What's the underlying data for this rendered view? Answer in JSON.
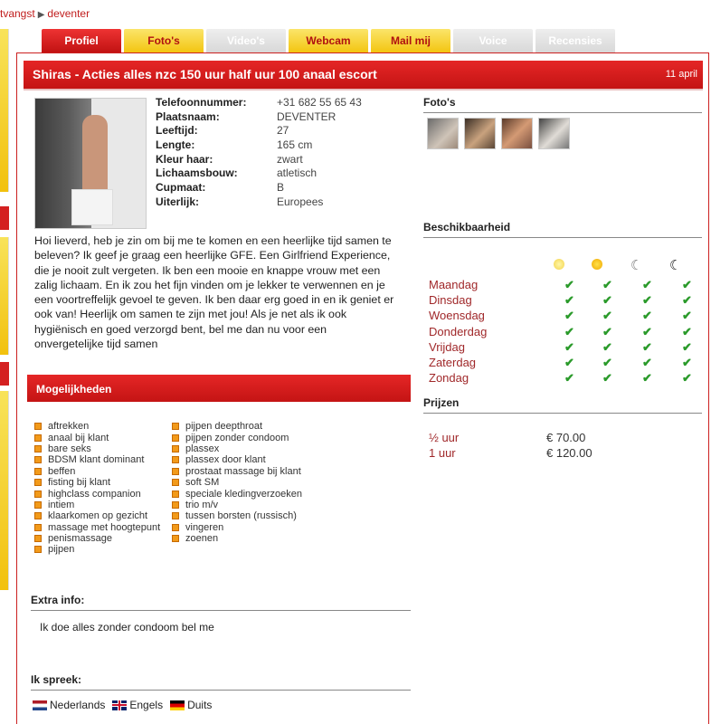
{
  "breadcrumb": {
    "first": "tvangst",
    "second": "deventer"
  },
  "tabs": [
    {
      "label": "Profiel"
    },
    {
      "label": "Foto's"
    },
    {
      "label": "Video's"
    },
    {
      "label": "Webcam"
    },
    {
      "label": "Mail mij"
    },
    {
      "label": "Voice"
    },
    {
      "label": "Recensies"
    }
  ],
  "profile": {
    "title": "Shiras - Acties alles nzc 150 uur half uur 100 anaal escort",
    "date": "11 april",
    "details": [
      {
        "label": "Telefoonnummer:",
        "value": "+31 682 55 65 43"
      },
      {
        "label": "Plaatsnaam:",
        "value": "DEVENTER"
      },
      {
        "label": "Leeftijd:",
        "value": "27"
      },
      {
        "label": "Lengte:",
        "value": "165 cm"
      },
      {
        "label": "Kleur haar:",
        "value": "zwart"
      },
      {
        "label": "Lichaamsbouw:",
        "value": "atletisch"
      },
      {
        "label": "Cupmaat:",
        "value": "B"
      },
      {
        "label": "Uiterlijk:",
        "value": "Europees"
      }
    ],
    "description": "Hoi lieverd, heb je zin om bij me te komen en een heerlijke tijd samen te beleven? Ik geef je graag een heerlijke GFE. Een Girlfriend Experience, die je nooit zult vergeten. Ik ben een mooie en knappe vrouw met een zalig lichaam. En ik zou het fijn vinden om je lekker te verwennen en je een voortreffelijk gevoel te geven. Ik ben daar erg goed in en ik geniet er ook van! Heerlijk om samen te zijn met jou! Als je net als ik ook hygiënisch en goed verzorgd bent, bel me dan nu voor een onvergetelijke tijd samen"
  },
  "mogelijkheden": {
    "heading": "Mogelijkheden",
    "col1": [
      "aftrekken",
      "anaal bij klant",
      "bare seks",
      "BDSM klant dominant",
      "beffen",
      "fisting bij klant",
      "highclass companion",
      "intiem",
      "klaarkomen op gezicht",
      "massage met hoogtepunt",
      "penismassage",
      "pijpen"
    ],
    "col2": [
      "pijpen deepthroat",
      "pijpen zonder condoom",
      "plassex",
      "plassex door klant",
      "prostaat massage bij klant",
      "soft SM",
      "speciale kledingverzoeken",
      "trio m/v",
      "tussen borsten (russisch)",
      "vingeren",
      "zoenen"
    ]
  },
  "extra": {
    "heading": "Extra info:",
    "text": "Ik doe alles zonder condoom bel me"
  },
  "languages": {
    "heading": "Ik spreek:",
    "items": [
      "Nederlands",
      "Engels",
      "Duits"
    ]
  },
  "fotos": {
    "heading": "Foto's"
  },
  "availability": {
    "heading": "Beschikbaarheid",
    "days": [
      "Maandag",
      "Dinsdag",
      "Woensdag",
      "Donderdag",
      "Vrijdag",
      "Zaterdag",
      "Zondag"
    ],
    "check": "✔"
  },
  "prices": {
    "heading": "Prijzen",
    "rows": [
      {
        "duration": "½  uur",
        "price": "€ 70.00"
      },
      {
        "duration": "1   uur",
        "price": "€ 120.00"
      }
    ]
  },
  "colors": {
    "accent_red": "#c41414",
    "tab_yellow": "#f3c511",
    "day_red": "#a0282a",
    "check_green": "#2a9a2a"
  }
}
